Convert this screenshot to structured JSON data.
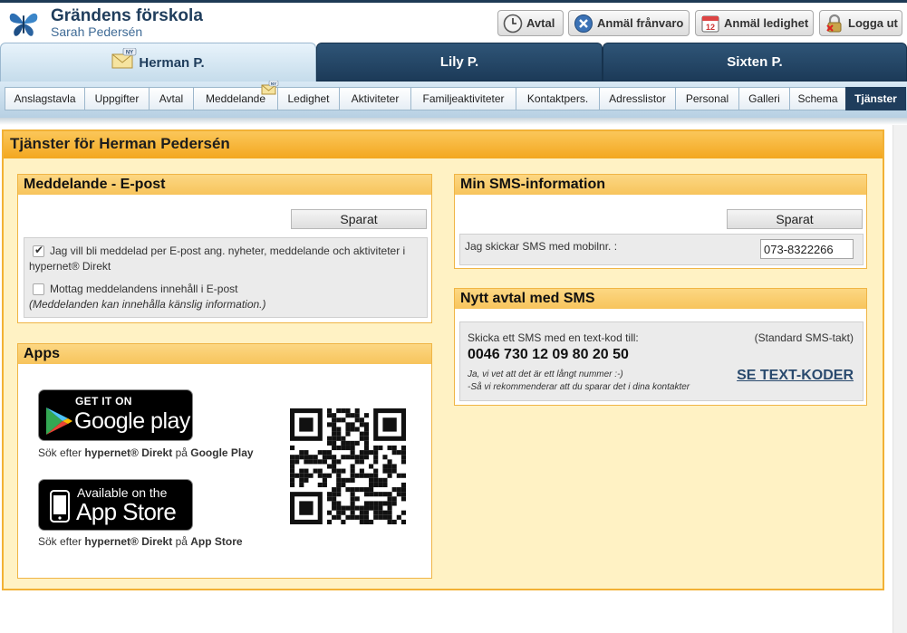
{
  "header": {
    "school_name": "Grändens förskola",
    "user_name": "Sarah Pedersén",
    "buttons": [
      {
        "label": "Avtal",
        "icon": "clock-icon"
      },
      {
        "label": "Anmäl frånvaro",
        "icon": "cancel-icon"
      },
      {
        "label": "Anmäl ledighet",
        "icon": "calendar-icon"
      },
      {
        "label": "Logga ut",
        "icon": "lock-icon"
      }
    ],
    "calendar_day": "12"
  },
  "child_tabs": [
    {
      "label": "Herman P.",
      "active": true,
      "badge": "NY"
    },
    {
      "label": "Lily P.",
      "active": false
    },
    {
      "label": "Sixten P.",
      "active": false
    }
  ],
  "subnav": [
    {
      "label": "Anslagstavla"
    },
    {
      "label": "Uppgifter"
    },
    {
      "label": "Avtal"
    },
    {
      "label": "Meddelande",
      "badge": "NY"
    },
    {
      "label": "Ledighet"
    },
    {
      "label": "Aktiviteter"
    },
    {
      "label": "Familjeaktiviteter"
    },
    {
      "label": "Kontaktpers."
    },
    {
      "label": "Adresslistor"
    },
    {
      "label": "Personal"
    },
    {
      "label": "Galleri"
    },
    {
      "label": "Schema"
    },
    {
      "label": "Tjänster",
      "active": true
    }
  ],
  "main": {
    "title": "Tjänster för Herman Pedersén",
    "email": {
      "title": "Meddelande - E-post",
      "save_label": "Sparat",
      "option1": "Jag vill bli meddelad per E-post ang. nyheter, meddelande och aktiviteter i hypernet® Direkt",
      "option1_checked": true,
      "option2": "Mottag meddelandens innehåll i E-post",
      "option2_checked": false,
      "note": "(Meddelanden kan innehålla känslig information.)"
    },
    "sms_info": {
      "title": "Min SMS-information",
      "save_label": "Sparat",
      "label": "Jag skickar SMS med mobilnr. :",
      "phone": "073-8322266"
    },
    "sms_agreement": {
      "title": "Nytt avtal med SMS",
      "intro": "Skicka ett SMS med en text-kod till:",
      "rate": "(Standard SMS-takt)",
      "number": "0046 730 12 09 80 20 50",
      "note1": "Ja, vi vet att det är ett långt nummer :-)",
      "note2": "-Så vi rekommenderar att du sparar det i dina kontakter",
      "link": "SE TEXT-KODER"
    },
    "apps": {
      "title": "Apps",
      "google_small": "GET IT ON",
      "google_big": "Google play",
      "google_pre": "Sök efter ",
      "google_bold1": "hypernet® Direkt",
      "google_mid": " på ",
      "google_bold2": "Google Play",
      "apple_small": "Available on the",
      "apple_big": "App Store",
      "apple_pre": "Sök efter ",
      "apple_bold1": "hypernet® Direkt",
      "apple_mid": " på ",
      "apple_bold2": "App Store"
    }
  },
  "colors": {
    "navy": "#1f3d5c",
    "orange": "#f3a71f",
    "panel": "#fff2c4",
    "link": "#2a4a6e"
  }
}
